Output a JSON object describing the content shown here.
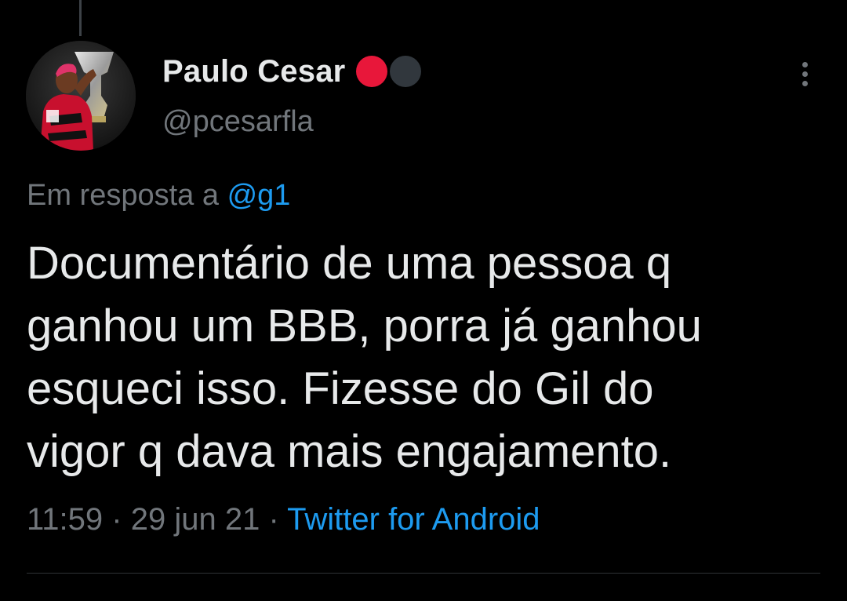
{
  "author": {
    "display_name": "Paulo Cesar",
    "handle": "@pcesarfla",
    "name_emoji": [
      "red-circle-icon",
      "black-circle-icon"
    ]
  },
  "reply": {
    "prefix": "Em resposta a",
    "mention": "@g1"
  },
  "tweet": {
    "lines": [
      "Documentário de uma pessoa q",
      "ganhou um BBB, porra já ganhou",
      "esqueci isso. Fizesse do Gil do",
      "vigor q dava mais engajamento."
    ]
  },
  "meta": {
    "time": "11:59",
    "separator": "·",
    "date": "29 jun 21",
    "source": "Twitter for Android"
  },
  "colors": {
    "background": "#000000",
    "text": "#e7e9ea",
    "secondary": "#71767b",
    "accent": "#1d9bf0",
    "emoji_red": "#e8173a",
    "emoji_black": "#31373d"
  }
}
